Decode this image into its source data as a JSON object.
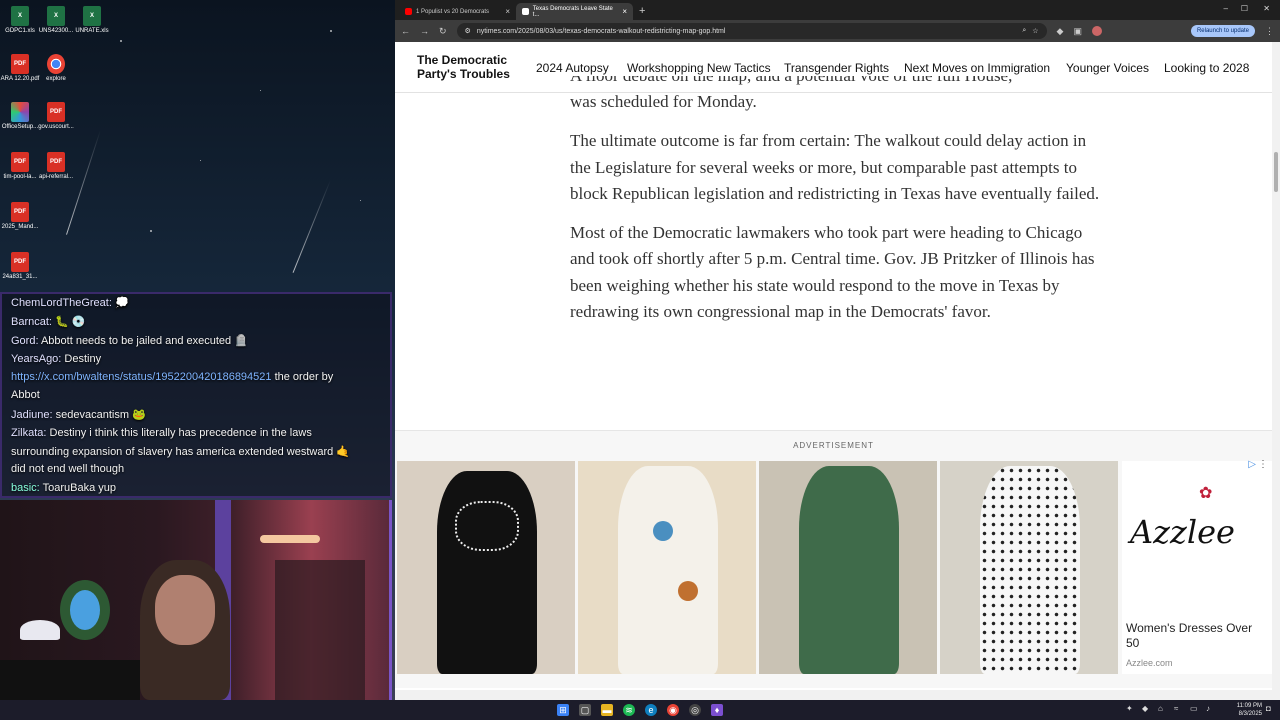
{
  "desktop": {
    "icons": [
      {
        "label": "GDPC1.xls",
        "type": "xls"
      },
      {
        "label": "UNS42300...",
        "type": "xls"
      },
      {
        "label": "UNRATE.xls",
        "type": "xls"
      },
      {
        "label": "ARA 12.20.pdf",
        "type": "pdf"
      },
      {
        "label": "explore",
        "type": "chrome"
      },
      {
        "label": "OfficeSetup...",
        "type": "office"
      },
      {
        "label": "gov.uscourt...",
        "type": "pdf"
      },
      {
        "label": "tim-pool-la...",
        "type": "pdf"
      },
      {
        "label": "api-referral...",
        "type": "pdf"
      },
      {
        "label": "2025_Mand...",
        "type": "pdf"
      },
      {
        "label": "24a831_31...",
        "type": "pdf"
      }
    ]
  },
  "chat": {
    "messages": [
      {
        "user": "ChemLordTheGreat:",
        "text": " 💭"
      },
      {
        "user": "Barncat:",
        "text": " 🐛 💿"
      },
      {
        "user": "Gord:",
        "text": " Abbott needs to be jailed and executed 🪦"
      },
      {
        "user": "YearsAgo:",
        "text": " Destiny"
      },
      {
        "user": "",
        "link": "https://x.com/bwaltens/status/1952200420186894521",
        "text": " the order by"
      },
      {
        "user": "",
        "text": "Abbot"
      },
      {
        "user": "Jadiune:",
        "text": " sedevacantism 🐸"
      },
      {
        "user": "Zilkata:",
        "text": " Destiny i think this literally has precedence in the laws"
      },
      {
        "user": "",
        "text": "surrounding expansion of slavery has america extended westward 🤙"
      },
      {
        "user": "",
        "text": "did not end well though"
      },
      {
        "user": "basic:",
        "text": " ToaruBaka yup"
      }
    ]
  },
  "browser": {
    "tabs": [
      {
        "title": "1 Populist vs 20 Democrats",
        "active": false
      },
      {
        "title": "Texas Democrats Leave State t...",
        "active": true
      }
    ],
    "new_tab_label": "+",
    "url": "nytimes.com/2025/08/03/us/texas-democrats-walkout-redistricting-map-gop.html",
    "relaunch_label": "Relaunch to update"
  },
  "site": {
    "title_line1": "The Democratic",
    "title_line2": "Party's Troubles",
    "nav": [
      "2024 Autopsy",
      "Workshopping New Tactics",
      "Transgender Rights",
      "Next Moves on Immigration",
      "Younger Voices",
      "Looking to 2028"
    ]
  },
  "article": {
    "partial_line": "A floor debate on the map, and a potential vote of the full House,",
    "p1_end": "was scheduled for Monday.",
    "p2": "The ultimate outcome is far from certain: The walkout could delay action in the Legislature for several weeks or more, but comparable past attempts to block Republican legislation and redistricting in Texas have eventually failed.",
    "p3": "Most of the Democratic lawmakers who took part were heading to Chicago and took off shortly after 5 p.m. Central time. Gov. JB Pritzker of Illinois has been weighing whether his state would respond to the move in Texas by redrawing its own congressional map in the Democrats' favor."
  },
  "ad": {
    "label": "ADVERTISEMENT",
    "brand": "Azzlee",
    "headline": "Women's Dresses Over 50",
    "domain": "Azzlee.com",
    "dress_colors": [
      "#111111",
      "#f4f1ea",
      "#3f6b4a",
      "#f7f7f7"
    ]
  },
  "taskbar": {
    "time": "11:09 PM",
    "date": "8/3/2025"
  }
}
